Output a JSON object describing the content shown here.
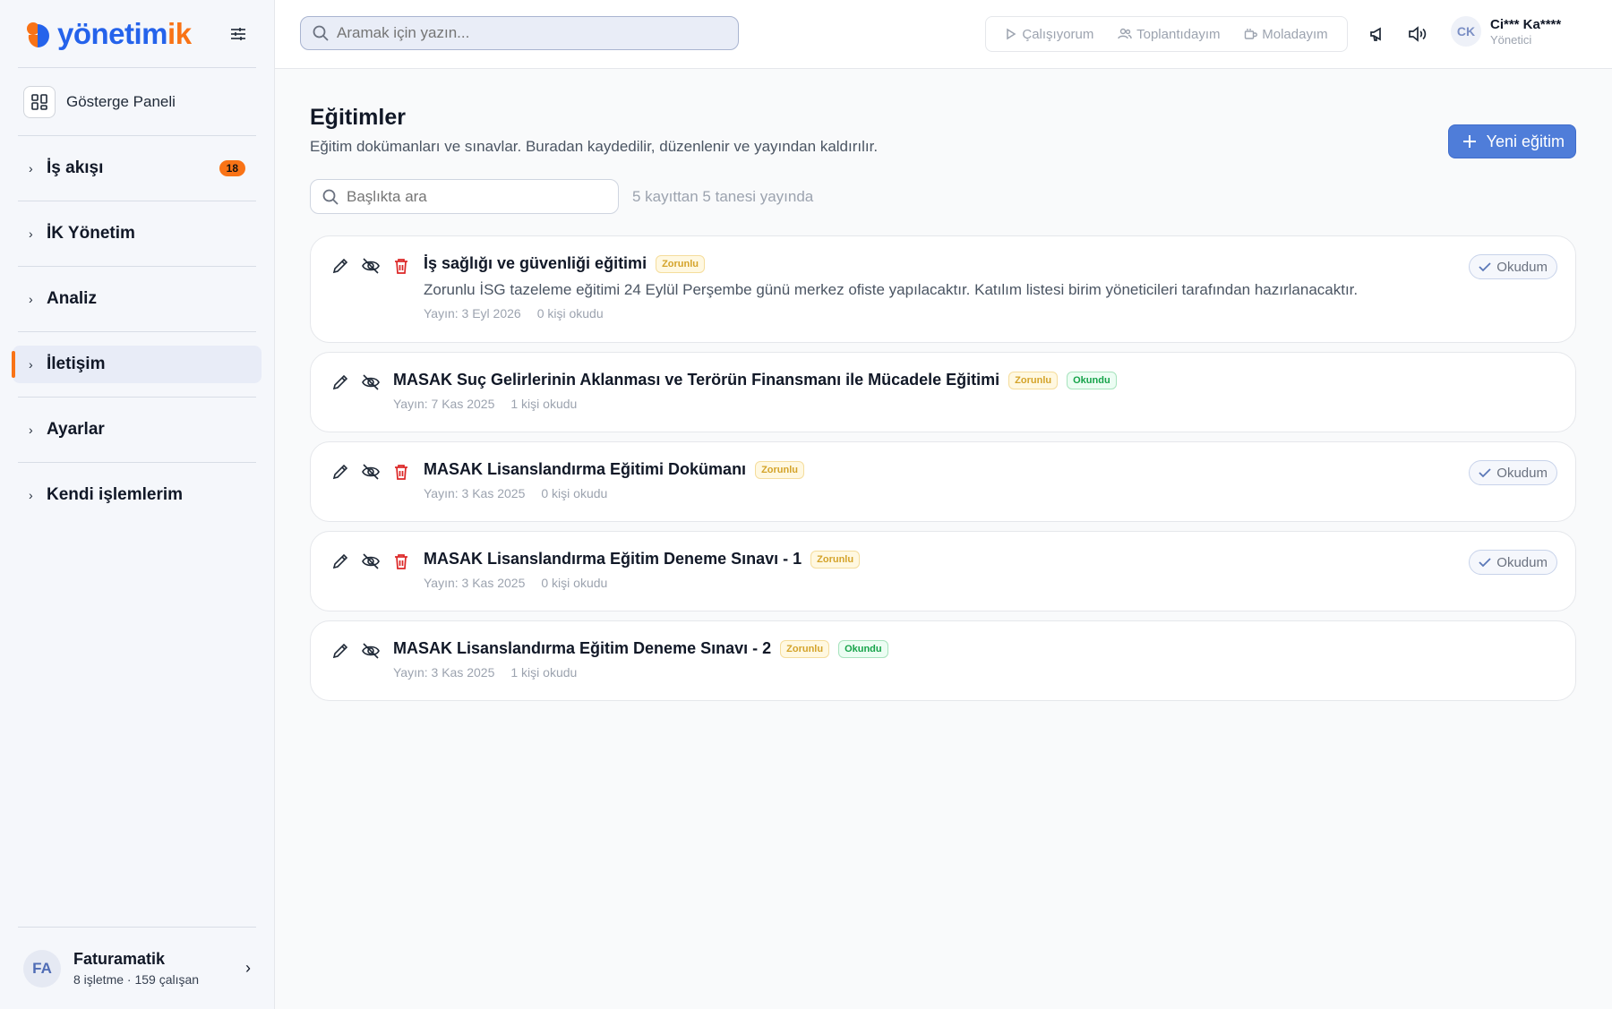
{
  "brand": {
    "name_main": "yönetim",
    "name_accent": "ik",
    "color_primary": "#2563eb",
    "color_accent": "#f97316"
  },
  "sidebar": {
    "dashboard_label": "Gösterge Paneli",
    "items": [
      {
        "label": "İş akışı",
        "badge": "18",
        "active": false
      },
      {
        "label": "İK Yönetim",
        "active": false
      },
      {
        "label": "Analiz",
        "active": false
      },
      {
        "label": "İletişim",
        "active": true
      },
      {
        "label": "Ayarlar",
        "active": false
      },
      {
        "label": "Kendi işlemlerim",
        "active": false
      }
    ],
    "footer": {
      "avatar": "FA",
      "name": "Faturamatik",
      "sub": "8 işletme · 159 çalışan"
    }
  },
  "topbar": {
    "search_placeholder": "Aramak için yazın...",
    "status": [
      {
        "label": "Çalışıyorum",
        "icon": "play-icon"
      },
      {
        "label": "Toplantıdayım",
        "icon": "users-icon"
      },
      {
        "label": "Moladayım",
        "icon": "coffee-icon"
      }
    ],
    "user": {
      "initials": "CK",
      "name": "Ci*** Ka****",
      "role": "Yönetici"
    }
  },
  "page": {
    "title": "Eğitimler",
    "description": "Eğitim dokümanları ve sınavlar. Buradan kaydedilir, düzenlenir ve yayından kaldırılır.",
    "new_button": "Yeni eğitim",
    "search_placeholder": "Başlıkta ara",
    "record_count": "5 kayıttan 5 tanesi yayında"
  },
  "trainings": [
    {
      "title": "İş sağlığı ve güvenliği eğitimi",
      "tag_required": "Zorunlu",
      "tag_read": "",
      "text": "Zorunlu İSG tazeleme eğitimi 24 Eylül Perşembe günü merkez ofiste yapılacaktır. Katılım listesi birim yöneticileri tarafından hazırlanacaktır.",
      "published": "Yayın: 3 Eyl 2026",
      "readers": "0 kişi okudu",
      "read_button": "Okudum",
      "deletable": true
    },
    {
      "title": "MASAK Suç Gelirlerinin Aklanması ve Terörün Finansmanı ile Mücadele Eğitimi",
      "tag_required": "Zorunlu",
      "tag_read": "Okundu",
      "text": "",
      "published": "Yayın: 7 Kas 2025",
      "readers": "1 kişi okudu",
      "read_button": "",
      "deletable": false
    },
    {
      "title": "MASAK Lisanslandırma Eğitimi Dokümanı",
      "tag_required": "Zorunlu",
      "tag_read": "",
      "text": "",
      "published": "Yayın: 3 Kas 2025",
      "readers": "0 kişi okudu",
      "read_button": "Okudum",
      "deletable": true
    },
    {
      "title": "MASAK Lisanslandırma Eğitim Deneme Sınavı - 1",
      "tag_required": "Zorunlu",
      "tag_read": "",
      "text": "",
      "published": "Yayın: 3 Kas 2025",
      "readers": "0 kişi okudu",
      "read_button": "Okudum",
      "deletable": true
    },
    {
      "title": "MASAK Lisanslandırma Eğitim Deneme Sınavı - 2",
      "tag_required": "Zorunlu",
      "tag_read": "Okundu",
      "text": "",
      "published": "Yayın: 3 Kas 2025",
      "readers": "1 kişi okudu",
      "read_button": "",
      "deletable": false
    }
  ]
}
